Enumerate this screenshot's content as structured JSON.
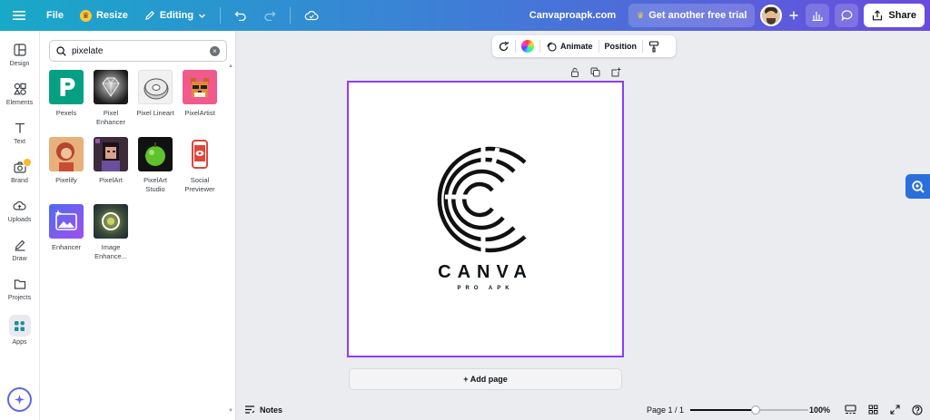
{
  "topbar": {
    "menu": {
      "file": "File",
      "resize": "Resize",
      "editing": "Editing"
    },
    "site": "Canvaproapk.com",
    "trial": "Get another free trial",
    "share": "Share"
  },
  "rail": {
    "items": [
      {
        "label": "Design"
      },
      {
        "label": "Elements"
      },
      {
        "label": "Text"
      },
      {
        "label": "Brand"
      },
      {
        "label": "Uploads"
      },
      {
        "label": "Draw"
      },
      {
        "label": "Projects"
      },
      {
        "label": "Apps"
      }
    ]
  },
  "panel": {
    "search_value": "pixelate",
    "apps": [
      {
        "label": "Pexels"
      },
      {
        "label": "Pixel Enhancer"
      },
      {
        "label": "Pixel Lineart"
      },
      {
        "label": "PixelArtist"
      },
      {
        "label": "Pixelify"
      },
      {
        "label": "PixelArt"
      },
      {
        "label": "PixelArt Studio"
      },
      {
        "label": "Social Previewer"
      },
      {
        "label": "Enhancer"
      },
      {
        "label": "Image Enhance..."
      }
    ]
  },
  "context_toolbar": {
    "animate": "Animate",
    "position": "Position"
  },
  "design": {
    "brand": "CANVA",
    "tagline": "PRO APK"
  },
  "add_page": "+ Add page",
  "bottombar": {
    "notes": "Notes",
    "page_indicator": "Page 1 / 1",
    "zoom": "100%",
    "zoom_level_fraction": 0.55
  },
  "colors": {
    "accent_purple": "#8b3dff",
    "topbar_start": "#18a9c8",
    "topbar_end": "#6a4bde",
    "pexels_green": "#05a081",
    "fab_blue": "#2a6fdb"
  }
}
